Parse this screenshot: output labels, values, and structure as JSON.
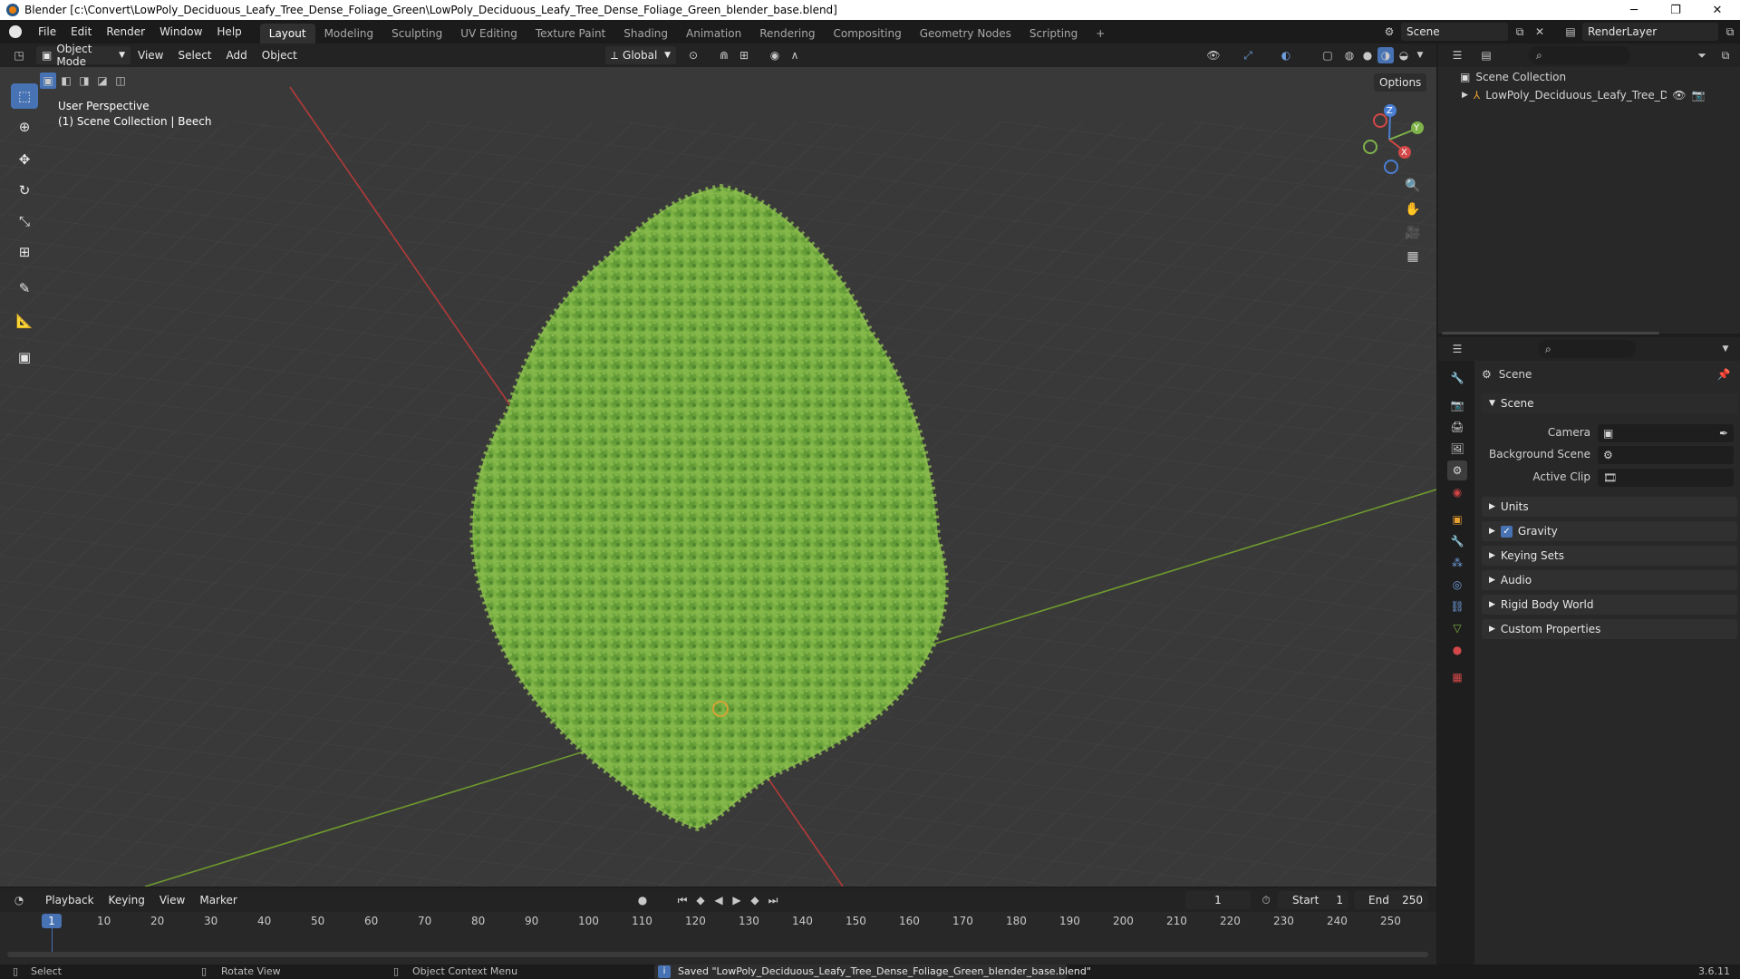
{
  "window": {
    "title": "Blender [c:\\Convert\\LowPoly_Deciduous_Leafy_Tree_Dense_Foliage_Green\\LowPoly_Deciduous_Leafy_Tree_Dense_Foliage_Green_blender_base.blend]",
    "minimize": "─",
    "maximize": "❐",
    "close": "✕"
  },
  "menu": [
    "File",
    "Edit",
    "Render",
    "Window",
    "Help"
  ],
  "workspaces": [
    "Layout",
    "Modeling",
    "Sculpting",
    "UV Editing",
    "Texture Paint",
    "Shading",
    "Animation",
    "Rendering",
    "Compositing",
    "Geometry Nodes",
    "Scripting",
    "+"
  ],
  "scene_selector": "Scene",
  "view_layer": "RenderLayer",
  "viewport_header": {
    "mode": "Object Mode",
    "menus": [
      "View",
      "Select",
      "Add",
      "Object"
    ],
    "orientation": "Global",
    "options": "Options"
  },
  "viewport": {
    "perspective": "User Perspective",
    "collection_info": "(1) Scene Collection | Beech",
    "gizmo": {
      "x": "X",
      "y": "Y",
      "z": "Z"
    }
  },
  "outliner": {
    "root": "Scene Collection",
    "items": [
      {
        "label": "LowPoly_Deciduous_Leafy_Tree_Dense_"
      }
    ]
  },
  "properties": {
    "context": "Scene",
    "section": "Scene",
    "fields": [
      {
        "label": "Camera"
      },
      {
        "label": "Background Scene"
      },
      {
        "label": "Active Clip"
      }
    ],
    "panels": [
      "Units",
      "Gravity",
      "Keying Sets",
      "Audio",
      "Rigid Body World",
      "Custom Properties"
    ],
    "gravity_enabled": true
  },
  "timeline": {
    "menus": [
      "Playback",
      "Keying",
      "View",
      "Marker"
    ],
    "current_frame": "1",
    "start_label": "Start",
    "start": "1",
    "end_label": "End",
    "end": "250",
    "ticks": [
      "10",
      "20",
      "30",
      "40",
      "50",
      "60",
      "70",
      "80",
      "90",
      "100",
      "110",
      "120",
      "130",
      "140",
      "150",
      "160",
      "170",
      "180",
      "190",
      "200",
      "210",
      "220",
      "230",
      "240",
      "250"
    ],
    "frame_badge": "1"
  },
  "statusbar": {
    "select": "Select",
    "rotate": "Rotate View",
    "context_menu": "Object Context Menu",
    "message": "Saved \"LowPoly_Deciduous_Leafy_Tree_Dense_Foliage_Green_blender_base.blend\"",
    "version": "3.6.11"
  },
  "colors": {
    "accent": "#4772b3",
    "x_axis": "#c83434",
    "y_axis": "#6f9a2e",
    "foliage": "#6aa33a"
  }
}
